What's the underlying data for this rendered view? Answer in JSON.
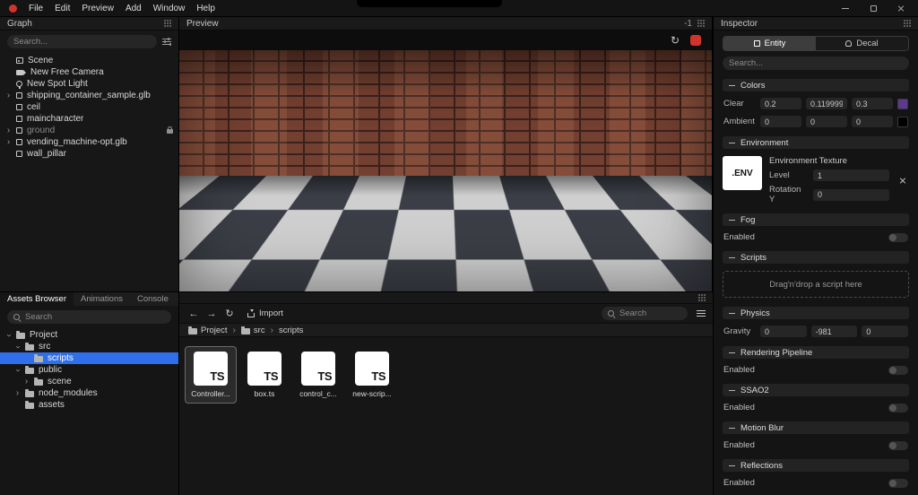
{
  "theme": {
    "accent": "#2f6feb",
    "record_red": "#d0342c",
    "logo_red": "#d0342c"
  },
  "menubar": {
    "items": [
      "File",
      "Edit",
      "Preview",
      "Add",
      "Window",
      "Help"
    ]
  },
  "graph": {
    "title": "Graph",
    "search_placeholder": "Search...",
    "items": [
      {
        "label": "Scene"
      },
      {
        "label": "New Free Camera"
      },
      {
        "label": "New Spot Light"
      },
      {
        "label": "shipping_container_sample.glb"
      },
      {
        "label": "ceil"
      },
      {
        "label": "maincharacter"
      },
      {
        "label": "ground",
        "locked": true,
        "dimmed": true
      },
      {
        "label": "vending_machine-opt.glb"
      },
      {
        "label": "wall_pillar"
      }
    ]
  },
  "preview": {
    "title": "Preview",
    "badge": "-1"
  },
  "assets_panel": {
    "tabs": [
      {
        "label": "Assets Browser",
        "active": true
      },
      {
        "label": "Animations",
        "active": false
      },
      {
        "label": "Console",
        "active": false
      }
    ],
    "search_placeholder": "Search",
    "tree": [
      {
        "label": "Project"
      },
      {
        "label": "src"
      },
      {
        "label": "scripts",
        "selected": true
      },
      {
        "label": "public"
      },
      {
        "label": "scene"
      },
      {
        "label": "node_modules"
      },
      {
        "label": "assets"
      }
    ]
  },
  "browser": {
    "import_label": "Import",
    "search_placeholder": "Search",
    "breadcrumb": [
      "Project",
      "src",
      "scripts"
    ],
    "files": [
      {
        "name": "Controller...",
        "type": "TS",
        "selected": true
      },
      {
        "name": "box.ts",
        "type": "TS",
        "selected": false
      },
      {
        "name": "control_c...",
        "type": "TS",
        "selected": false
      },
      {
        "name": "new-scrip...",
        "type": "TS",
        "selected": false
      }
    ]
  },
  "inspector": {
    "title": "Inspector",
    "tabs": [
      {
        "label": "Entity",
        "active": true
      },
      {
        "label": "Decal",
        "active": false
      }
    ],
    "search_placeholder": "Search...",
    "colors": {
      "title": "Colors",
      "clear_label": "Clear",
      "clear": {
        "r": "0.2",
        "g": "0.11999999",
        "b": "0.3",
        "swatch": "#5b3a8f"
      },
      "ambient_label": "Ambient",
      "ambient": {
        "r": "0",
        "g": "0",
        "b": "0",
        "swatch": "#000000"
      }
    },
    "environment": {
      "title": "Environment",
      "texture_label": "Environment Texture",
      "thumb_text": ".ENV",
      "level_label": "Level",
      "level_value": "1",
      "rotation_label": "Rotation Y",
      "rotation_value": "0"
    },
    "fog": {
      "title": "Fog",
      "enabled_label": "Enabled",
      "enabled": false
    },
    "scripts": {
      "title": "Scripts",
      "dropzone": "Drag'n'drop a script here"
    },
    "physics": {
      "title": "Physics",
      "gravity_label": "Gravity",
      "x": "0",
      "y": "-981",
      "z": "0"
    },
    "rendering": {
      "title": "Rendering Pipeline",
      "enabled_label": "Enabled",
      "enabled": false
    },
    "ssao": {
      "title": "SSAO2",
      "enabled_label": "Enabled",
      "enabled": false
    },
    "motion_blur": {
      "title": "Motion Blur",
      "enabled_label": "Enabled",
      "enabled": false
    },
    "reflections": {
      "title": "Reflections",
      "enabled_label": "Enabled",
      "enabled": false
    }
  }
}
